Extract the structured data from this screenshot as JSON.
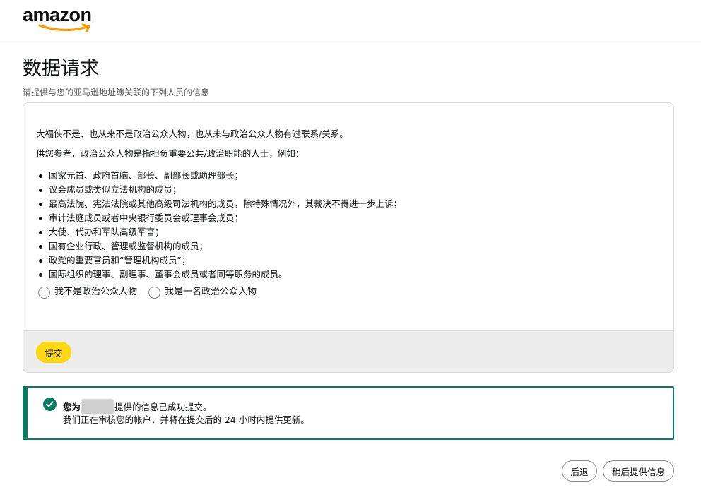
{
  "header": {
    "logo_text": "amazon"
  },
  "page": {
    "title": "数据请求",
    "subtitle": "请提供与您的亚马逊地址簿关联的下列人员的信息"
  },
  "card": {
    "intro": "大福侠不是、也从来不是政治公众人物，也从未与政治公众人物有过联系/关系。",
    "reference": "供您参考，政治公众人物是指担负重要公共/政治职能的人士，例如：",
    "bullets": [
      "国家元首、政府首脑、部长、副部长或助理部长；",
      "议会成员或类似立法机构的成员；",
      "最高法院、宪法法院或其他高级司法机构的成员，除特殊情况外，其裁决不得进一步上诉；",
      "审计法庭成员或者中央银行委员会或理事会成员；",
      "大使、代办和军队高级军官；",
      "国有企业行政、管理或监督机构的成员；",
      "政党的重要官员和“管理机构成员”；",
      "国际组织的理事、副理事、董事会成员或者同等职务的成员。"
    ],
    "radio_options": [
      "我不是政治公众人物",
      "我是一名政治公众人物"
    ],
    "submit_label": "提交"
  },
  "alert": {
    "prefix": "您为",
    "suffix": "提供的信息已成功提交。",
    "detail": "我们正在审核您的帐户，并将在提交后的 24 小时内提供更新。",
    "color": "#067d62"
  },
  "footer": {
    "back_label": "后退",
    "later_label": "稍后提供信息"
  },
  "colors": {
    "submit_button": "#ffd814",
    "success": "#067d62",
    "logo_smile": "#ff9900"
  }
}
